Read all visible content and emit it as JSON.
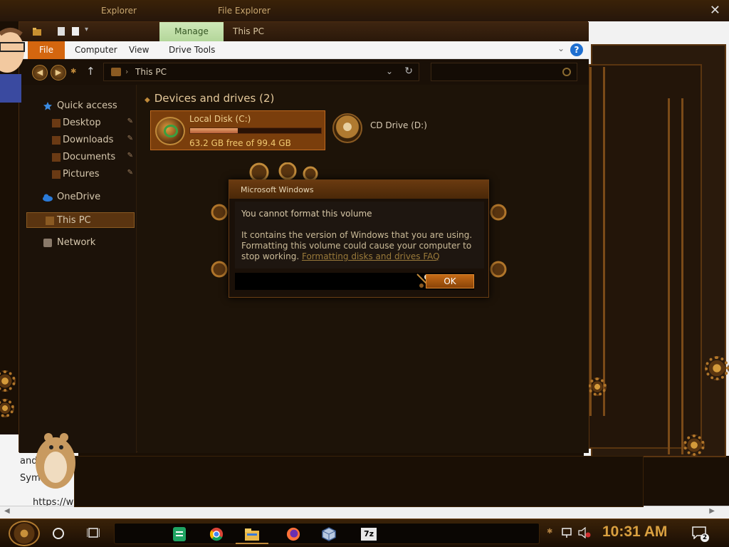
{
  "background": {
    "explorer_title_a": "Explorer",
    "explorer_title_b": "File Explorer",
    "close_glyph": "✕",
    "left_white_lines": [
      "and",
      "Sym"
    ],
    "left_url": "https://ww"
  },
  "window": {
    "manage_tab": "Manage",
    "title": "This PC",
    "ribbon_tabs": [
      "File",
      "Computer",
      "View",
      "Drive Tools"
    ],
    "help": "?",
    "address": {
      "path": "This PC",
      "back_icon": "back-arrow-icon",
      "forward_icon": "forward-arrow-icon"
    }
  },
  "nav": {
    "items": [
      {
        "label": "Quick access",
        "icon": "star-icon"
      },
      {
        "label": "Desktop",
        "icon": "desktop-folder-icon"
      },
      {
        "label": "Downloads",
        "icon": "downloads-folder-icon"
      },
      {
        "label": "Documents",
        "icon": "documents-folder-icon"
      },
      {
        "label": "Pictures",
        "icon": "pictures-folder-icon"
      },
      {
        "label": "OneDrive",
        "icon": "onedrive-cloud-icon"
      },
      {
        "label": "This PC",
        "icon": "computer-icon"
      },
      {
        "label": "Network",
        "icon": "network-icon"
      }
    ]
  },
  "content": {
    "section_title": "Devices and drives (2)",
    "drives": [
      {
        "name": "Local Disk (C:)",
        "free_text": "63.2 GB free of 99.4 GB",
        "used_fraction": 0.364
      },
      {
        "name": "CD Drive (D:)"
      }
    ]
  },
  "dialog": {
    "title": "Microsoft Windows",
    "main_instruction": "You cannot format this volume",
    "body": "It contains the version of Windows that you are using. Formatting this volume could cause your computer to stop working.",
    "link": "Formatting disks and drives FAQ",
    "ok_label": "OK"
  },
  "taskbar": {
    "clock": "10:31 AM",
    "notification_count": "2",
    "apps": [
      "sheets-icon",
      "chrome-icon",
      "file-explorer-icon",
      "firefox-icon",
      "virtualbox-icon",
      "7zip-icon"
    ],
    "sevenzip_label": "7z"
  },
  "colors": {
    "accent": "#d4660f",
    "manage_tab": "#b3d69a",
    "clock": "#d9a040",
    "ok_button": "#c46a16"
  }
}
